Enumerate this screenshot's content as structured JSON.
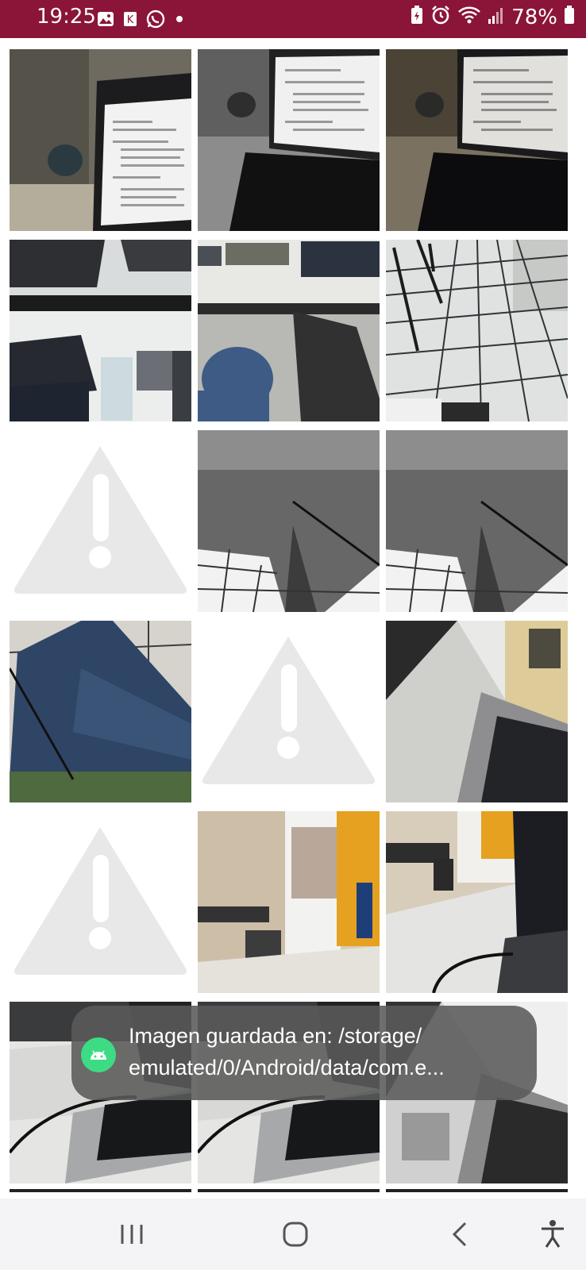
{
  "status_bar": {
    "time": "19:25",
    "battery_percent": "78%",
    "left_icons": [
      "gallery-icon",
      "app-icon",
      "whatsapp-icon",
      "dot-icon"
    ],
    "right_icons": [
      "battery-saver-icon",
      "alarm-icon",
      "wifi-icon",
      "signal-icon",
      "battery-icon"
    ],
    "bar_color": "#8a1538"
  },
  "gallery": {
    "tiles": [
      {
        "kind": "laptop-document"
      },
      {
        "kind": "laptop-document-bw"
      },
      {
        "kind": "laptop-document-dark"
      },
      {
        "kind": "desk-laptop-overhead"
      },
      {
        "kind": "desk-underside-jeans"
      },
      {
        "kind": "tiled-floor"
      },
      {
        "kind": "error-placeholder"
      },
      {
        "kind": "jeans-bw"
      },
      {
        "kind": "jeans-bw"
      },
      {
        "kind": "jeans-color"
      },
      {
        "kind": "error-placeholder"
      },
      {
        "kind": "laptop-angle"
      },
      {
        "kind": "error-placeholder"
      },
      {
        "kind": "classroom-door"
      },
      {
        "kind": "laptop-classroom"
      },
      {
        "kind": "laptop-keyboard"
      },
      {
        "kind": "laptop-keyboard"
      },
      {
        "kind": "laptop-angle-bw"
      }
    ]
  },
  "toast": {
    "line1": "Imagen guardada en: /storage/",
    "line2": "emulated/0/Android/data/com.e..."
  },
  "nav_bar": {
    "buttons": [
      "recents-button",
      "home-button",
      "back-button",
      "accessibility-button"
    ]
  }
}
